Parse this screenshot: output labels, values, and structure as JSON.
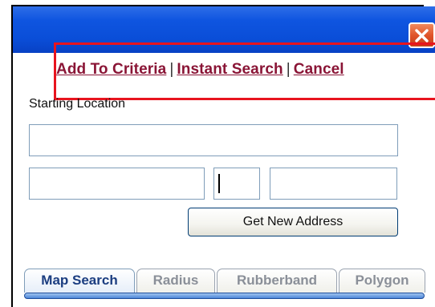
{
  "window": {
    "close_label": "×"
  },
  "actions": {
    "add_to_criteria": "Add To Criteria",
    "instant_search": "Instant Search",
    "cancel": "Cancel",
    "separator": "|"
  },
  "form": {
    "starting_location_label": "Starting Location",
    "address_value": "",
    "city_value": "",
    "state_value": "",
    "zip_value": "",
    "get_new_address_label": "Get New Address"
  },
  "tabs": [
    {
      "label": "Map Search",
      "active": true
    },
    {
      "label": "Radius",
      "active": false
    },
    {
      "label": "Rubberband",
      "active": false
    },
    {
      "label": "Polygon",
      "active": false
    }
  ],
  "colors": {
    "title_bar": "#0a4ed8",
    "link": "#8a1536",
    "highlight": "#e8141e",
    "close_button": "#e0542a"
  }
}
